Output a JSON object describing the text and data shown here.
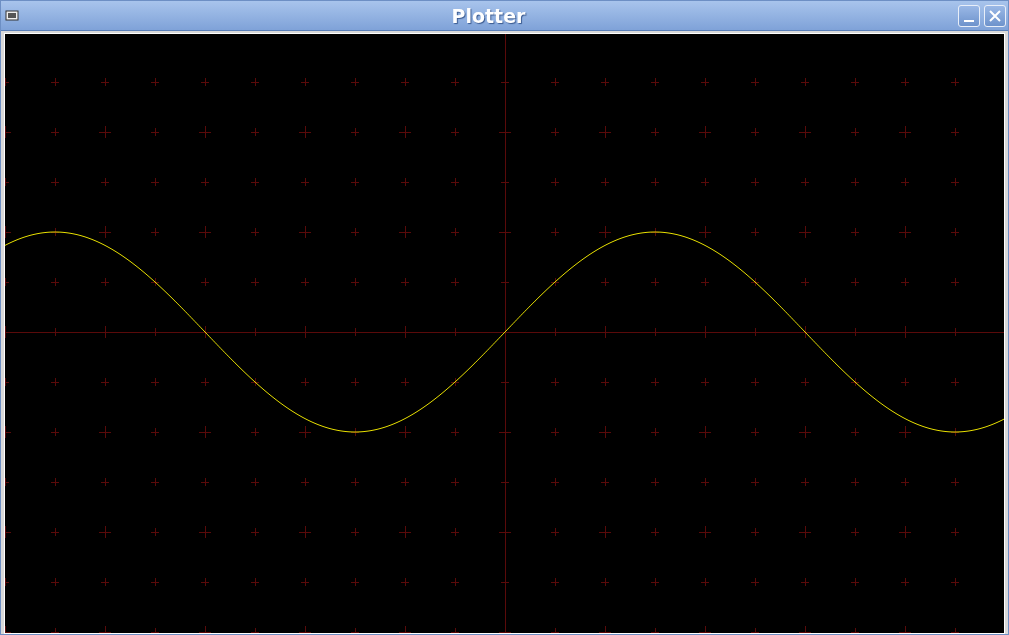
{
  "window": {
    "title": "Plotter"
  }
}
